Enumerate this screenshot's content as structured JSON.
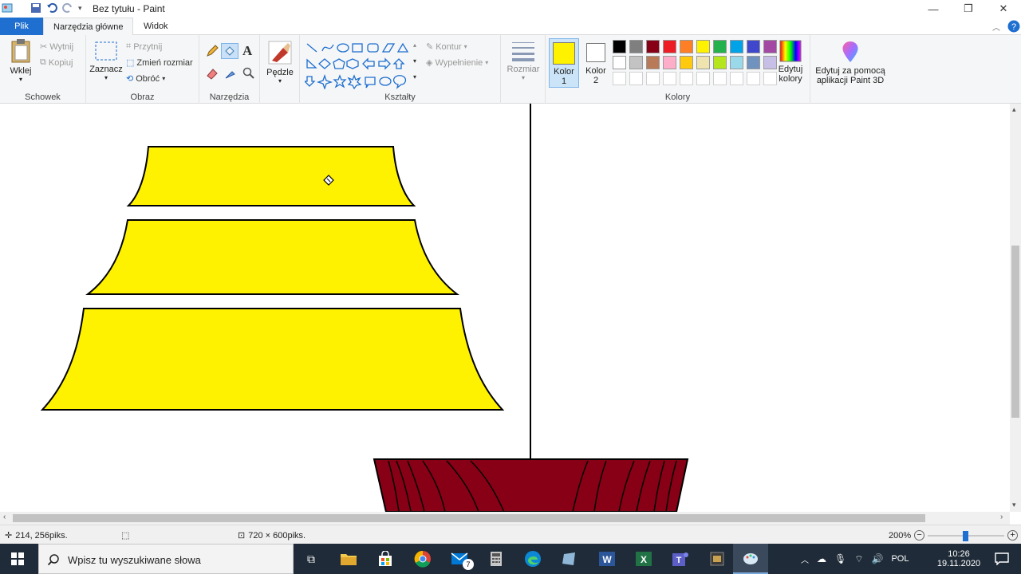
{
  "window": {
    "title": "Bez tytułu - Paint"
  },
  "tabs": [
    {
      "label": "Plik"
    },
    {
      "label": "Narzędzia główne"
    },
    {
      "label": "Widok"
    }
  ],
  "clipboard": {
    "paste": "Wklej",
    "cut": "Wytnij",
    "copy": "Kopiuj",
    "group": "Schowek"
  },
  "image": {
    "select": "Zaznacz",
    "crop": "Przytnij",
    "resize": "Zmień rozmiar",
    "rotate": "Obróć",
    "group": "Obraz"
  },
  "tools": {
    "group": "Narzędzia"
  },
  "brushes": {
    "label": "Pędzle"
  },
  "shapes": {
    "outline": "Kontur",
    "fill": "Wypełnienie",
    "group": "Kształty"
  },
  "size": {
    "label": "Rozmiar"
  },
  "colors": {
    "color1_label": "Kolor",
    "color1_num": "1",
    "color2_label": "Kolor",
    "color2_num": "2",
    "edit_label1": "Edytuj",
    "edit_label2": "kolory",
    "group": "Kolory",
    "color1_value": "#fff200",
    "color2_value": "#ffffff",
    "palette_row1": [
      "#000000",
      "#7f7f7f",
      "#880015",
      "#ed1c24",
      "#ff7f27",
      "#fff200",
      "#22b14c",
      "#00a2e8",
      "#3f48cc",
      "#a349a4"
    ],
    "palette_row2": [
      "#ffffff",
      "#c3c3c3",
      "#b97a57",
      "#ffaec9",
      "#ffc90e",
      "#efe4b0",
      "#b5e61d",
      "#99d9ea",
      "#7092be",
      "#c8bfe7"
    ],
    "palette_row3": [
      "#ffffff",
      "#ffffff",
      "#ffffff",
      "#ffffff",
      "#ffffff",
      "#ffffff",
      "#ffffff",
      "#ffffff",
      "#ffffff",
      "#ffffff"
    ]
  },
  "paint3d": {
    "line1": "Edytuj za pomocą",
    "line2": "aplikacji Paint 3D"
  },
  "status": {
    "cursor_pos": "214, 256piks.",
    "image_size": "720 × 600piks.",
    "zoom": "200%"
  },
  "taskbar": {
    "search_placeholder": "Wpisz tu wyszukiwane słowa",
    "mail_badge": "7",
    "lang": "POL",
    "time": "10:26",
    "date": "19.11.2020"
  }
}
